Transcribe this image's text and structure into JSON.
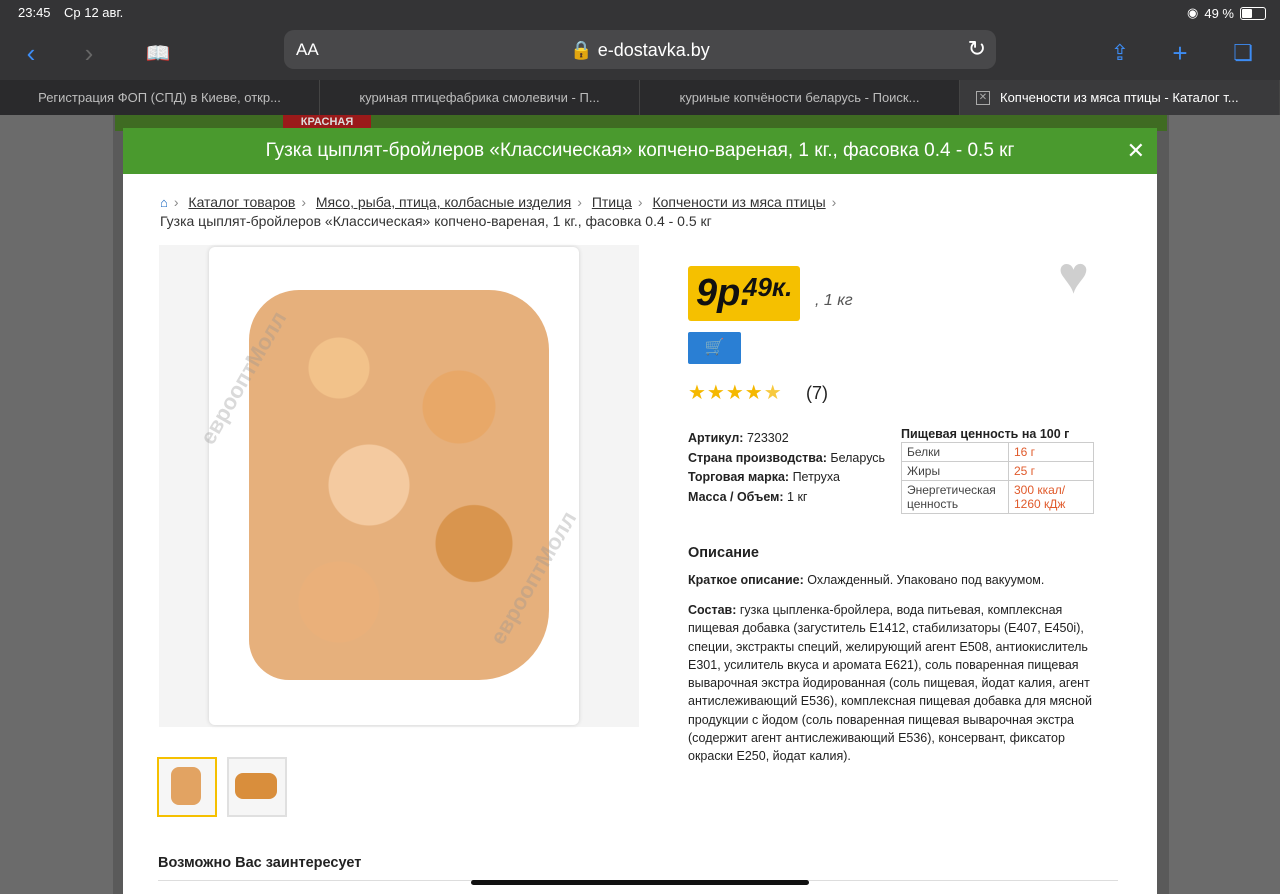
{
  "status": {
    "time": "23:45",
    "date": "Ср 12 авг.",
    "battery": "49 %"
  },
  "browser": {
    "aa": "AA",
    "url": "e-dostavka.by",
    "tabs": [
      "Регистрация ФОП (СПД) в Киеве, откр...",
      "куриная птицефабрика смолевичи - П...",
      "куриные копчёности беларусь - Поиск...",
      "Копчености из мяса птицы - Каталог т..."
    ]
  },
  "bg_logo": "КРАСНАЯ",
  "modal": {
    "title": "Гузка цыплят-бройлеров «Классическая» копчено-вареная, 1 кг., фасовка 0.4 - 0.5 кг"
  },
  "breadcrumb": [
    "Каталог товаров",
    "Мясо, рыба, птица, колбасные изделия",
    "Птица",
    "Копчености из мяса птицы"
  ],
  "breadcrumb_current": "Гузка цыплят-бройлеров «Классическая» копчено-вареная, 1 кг., фасовка 0.4 - 0.5 кг",
  "watermark": "еврооптМолл",
  "price": {
    "rub": "9р.",
    "kop": "49к.",
    "unit": ", 1 кг"
  },
  "rating": {
    "stars": 4.5,
    "count": "(7)"
  },
  "specs": [
    {
      "label": "Артикул:",
      "value": "723302"
    },
    {
      "label": "Страна производства:",
      "value": "Беларусь"
    },
    {
      "label": "Торговая марка:",
      "value": "Петруха"
    },
    {
      "label": "Масса / Объем:",
      "value": "1 кг"
    }
  ],
  "nutrition": {
    "title": "Пищевая ценность на 100 г",
    "rows": [
      {
        "name": "Белки",
        "value": "16 г"
      },
      {
        "name": "Жиры",
        "value": "25 г"
      },
      {
        "name": "Энергетическая ценность",
        "value": "300 ккал/ 1260 кДж"
      }
    ]
  },
  "description": {
    "heading": "Описание",
    "short_label": "Краткое описание:",
    "short_text": "Охлажденный. Упаковано под вакуумом.",
    "comp_label": "Состав:",
    "comp_text": "гузка цыпленка-бройлера, вода питьевая, комплексная пищевая добавка (загуститель Е1412, стабилизаторы (Е407, Е450i), специи, экстракты специй, желирующий агент Е508, антиокислитель Е301, усилитель вкуса и аромата Е621), соль поваренная пищевая выварочная экстра йодированная (соль пищевая, йодат калия, агент антислеживающий Е536), комплексная пищевая добавка для мясной продукции с йодом (соль поваренная пищевая выварочная экстра (содержит агент антислеживающий Е536), консервант, фиксатор окраски Е250, йодат калия)."
  },
  "also": "Возможно Вас заинтересует"
}
